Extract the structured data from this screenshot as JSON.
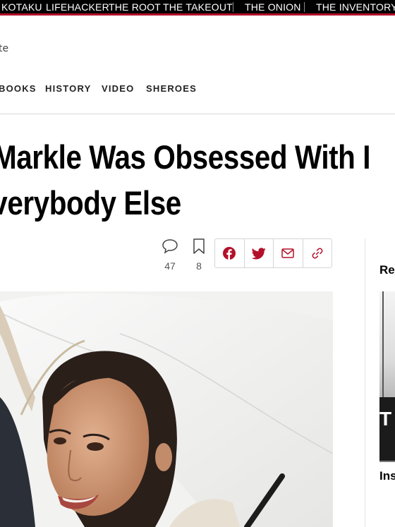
{
  "network_bar": {
    "items": [
      "KOTAKU",
      "LIFEHACKER",
      "THE ROOT",
      "THE TAKEOUT",
      "THE ONION",
      "THE INVENTORY"
    ]
  },
  "logo_fragment": "te",
  "nav": {
    "items": [
      "BOOKS",
      "HISTORY",
      "VIDEO",
      "SHEROES"
    ]
  },
  "article": {
    "headline_line1": "Markle Was Obsessed With I",
    "headline_line2": "verybody Else",
    "comments_count": "47",
    "bookmarks_count": "8"
  },
  "share": {
    "icons": [
      "facebook-icon",
      "twitter-icon",
      "email-icon",
      "link-icon"
    ],
    "accent_color": "#b3102a"
  },
  "sidebar": {
    "heading": "Rec",
    "thumb_text": "T",
    "caption": "Insi"
  },
  "colors": {
    "topbar_bg": "#000000",
    "topbar_accent": "#b3102a"
  }
}
